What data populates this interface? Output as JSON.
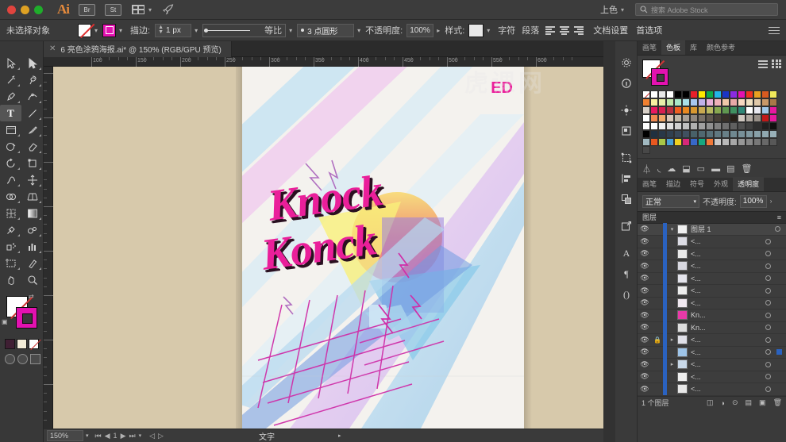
{
  "titlebar": {
    "app_name": "Ai",
    "buttons": [
      {
        "name": "bridge-button",
        "label": "Br"
      },
      {
        "name": "stock-button",
        "label": "St"
      }
    ],
    "arrange_icon": "arrange-documents-icon",
    "rocket_icon": "rocket-icon",
    "workspace_label": "上色",
    "search_placeholder": "搜索 Adobe Stock",
    "search_icon": "search-icon"
  },
  "controlbar": {
    "selection_label": "未选择对象",
    "fill_swatch": "none",
    "stroke_swatch": "#e312b0",
    "stroke_label": "描边:",
    "stroke_width": "1 px",
    "profile_label": "等比",
    "brush_label": "3 点圆形",
    "opacity_label": "不透明度:",
    "opacity_value": "100%",
    "style_label": "样式:",
    "character_label": "字符",
    "paragraph_label": "段落",
    "document_setup": "文档设置",
    "preferences": "首选项"
  },
  "document": {
    "tab_title": "6 亮色涂鸦海报.ai* @ 150% (RGB/GPU 预览)",
    "close_icon": "close-icon"
  },
  "toolbar": {
    "tools": [
      {
        "name": "selection-tool",
        "glyph": "selection"
      },
      {
        "name": "direct-selection-tool",
        "glyph": "direct"
      },
      {
        "name": "magic-wand-tool",
        "glyph": "wand"
      },
      {
        "name": "lasso-tool",
        "glyph": "lasso"
      },
      {
        "name": "pen-tool",
        "glyph": "pen"
      },
      {
        "name": "curvature-tool",
        "glyph": "curvature"
      },
      {
        "name": "type-tool",
        "glyph": "type",
        "active": true
      },
      {
        "name": "line-segment-tool",
        "glyph": "line"
      },
      {
        "name": "rectangle-tool",
        "glyph": "rect"
      },
      {
        "name": "paintbrush-tool",
        "glyph": "brush"
      },
      {
        "name": "shaper-tool",
        "glyph": "shaper"
      },
      {
        "name": "eraser-tool",
        "glyph": "eraser"
      },
      {
        "name": "rotate-tool",
        "glyph": "rotate"
      },
      {
        "name": "scale-tool",
        "glyph": "scale"
      },
      {
        "name": "width-tool",
        "glyph": "width"
      },
      {
        "name": "free-transform-tool",
        "glyph": "transform"
      },
      {
        "name": "shape-builder-tool",
        "glyph": "builder"
      },
      {
        "name": "perspective-grid-tool",
        "glyph": "perspective"
      },
      {
        "name": "mesh-tool",
        "glyph": "mesh"
      },
      {
        "name": "gradient-tool",
        "glyph": "gradient"
      },
      {
        "name": "eyedropper-tool",
        "glyph": "eyedropper"
      },
      {
        "name": "blend-tool",
        "glyph": "blend"
      },
      {
        "name": "symbol-sprayer-tool",
        "glyph": "symbol"
      },
      {
        "name": "column-graph-tool",
        "glyph": "graph"
      },
      {
        "name": "artboard-tool",
        "glyph": "artboard"
      },
      {
        "name": "slice-tool",
        "glyph": "slice"
      },
      {
        "name": "hand-tool",
        "glyph": "hand"
      },
      {
        "name": "zoom-tool",
        "glyph": "zoom"
      }
    ],
    "fill_label": "fill-swatch",
    "stroke_label": "stroke-swatch",
    "recent_colors": [
      "#3f1f33",
      "#f2ecd8",
      "none"
    ]
  },
  "artwork": {
    "heading_line1": "Knock",
    "heading_line2": "Konck",
    "badge": "ED",
    "accent_color": "#ea1f9a",
    "shadow_color": "#2a1020",
    "background": "#f4f2ee",
    "board_background": "#d7c9ab"
  },
  "rulers": {
    "h_labels": [
      "100",
      "150",
      "200",
      "250",
      "300",
      "350",
      "400",
      "450",
      "500",
      "550",
      "600"
    ]
  },
  "rail": {
    "icons": [
      "gear-icon",
      "info-icon",
      "brightness-icon",
      "align-icon",
      "transform-icon",
      "pathfinder-icon",
      "layers-stack-icon",
      "export-icon",
      "character-panel-icon",
      "paragraph-panel-icon",
      "glyphs-icon"
    ]
  },
  "panels": {
    "swatches": {
      "tabs": [
        {
          "label": "画笔",
          "active": false
        },
        {
          "label": "色板",
          "active": true
        },
        {
          "label": "库",
          "active": false
        },
        {
          "label": "颜色参考",
          "active": false
        }
      ],
      "list_view_icon": "list-view-icon",
      "grid_view_icon": "grid-view-icon",
      "rows": [
        [
          "none",
          "#ffffff",
          "#e8e8e8",
          "#ffffff",
          "#000000",
          "#000000",
          "#e8202a",
          "#ffe800",
          "#0fa94a",
          "#22b5e8",
          "#1a35c4",
          "#8a2be2",
          "#e312b0",
          "#ee3322",
          "#e8a020",
          "#d85a20",
          "#f0e85a",
          "#f08030"
        ],
        [
          "#f7f0a0",
          "#e8f0a8",
          "#c0e8a8",
          "#a8e8c8",
          "#a8e0e8",
          "#a8c8f0",
          "#c0b0e8",
          "#e8b0d8",
          "#f0b0b8",
          "#f0c8a8",
          "#e8a8a8",
          "#f8d8c0",
          "#f0e0c0",
          "#e0c8a8",
          "#c89868",
          "#a87848",
          "#d8d0c8"
        ],
        [
          "#e81860",
          "#d82050",
          "#b83040",
          "#f06020",
          "#e88820",
          "#d89830",
          "#c8a850",
          "#b8b860",
          "#88a850",
          "#609850",
          "#409060",
          "#308878",
          "#ffffff",
          "#e8e8f0",
          "#a0c8e8",
          "#e818a0",
          "#ffffff"
        ],
        [
          "#f08850",
          "#f0a868",
          "#d8c8b8",
          "#c0b8a8",
          "#a8a098",
          "#908880",
          "#787068",
          "#605850",
          "#484038",
          "#383028",
          "#282018",
          "#d0c8c0",
          "#b0a8a0",
          "#989088",
          "#c01818",
          "#e818a0",
          "#ffffff"
        ],
        [
          "#ffffff",
          "#f0f0f0",
          "#e0e0e0",
          "#d0d0d0",
          "#c0c0c0",
          "#b0b0b0",
          "#a0a0a0",
          "#909090",
          "#808080",
          "#707070",
          "#606060",
          "#505050",
          "#404040",
          "#303030",
          "#202020",
          "#101010",
          "#000000"
        ],
        [
          "#203040",
          "#283848",
          "#304050",
          "#384858",
          "#405060",
          "#486068",
          "#506870",
          "#587078",
          "#607880",
          "#688088",
          "#708890",
          "#789098",
          "#8098a0",
          "#88a0a8",
          "#90a8b0",
          "#98b0b8",
          "#a0b8c0"
        ],
        [
          "#e85820",
          "#a8c848",
          "#48a0d8",
          "#f0d020",
          "#d82878",
          "#3868c8",
          "#18a880",
          "#f07838",
          "#c8c8c8",
          "#b8b8b8",
          "#a8a8a8",
          "#989898",
          "#888888",
          "#787878",
          "#686868",
          "#585858",
          "#484848"
        ]
      ]
    },
    "transparency": {
      "tabs": [
        {
          "label": "画笔",
          "active": false
        },
        {
          "label": "描边",
          "active": false
        },
        {
          "label": "符号",
          "active": false
        },
        {
          "label": "外观",
          "active": false
        },
        {
          "label": "透明度",
          "active": true
        }
      ],
      "blend_mode": "正常",
      "opacity_label": "不透明度:",
      "opacity_value": "100%"
    },
    "layers": {
      "title": "图层",
      "root_layer": "图层 1",
      "items": [
        {
          "name": "<...",
          "locked": false,
          "selected": false,
          "thumb": "#dcdce4"
        },
        {
          "name": "<...",
          "locked": false,
          "selected": false,
          "thumb": "#e8e8e8"
        },
        {
          "name": "<...",
          "locked": false,
          "selected": false,
          "thumb": "#d8d8e0"
        },
        {
          "name": "<...",
          "locked": false,
          "selected": false,
          "thumb": "#e4e4ec"
        },
        {
          "name": "<...",
          "locked": false,
          "selected": false,
          "thumb": "#ededed"
        },
        {
          "name": "<...",
          "locked": false,
          "selected": false,
          "thumb": "#f0e8f0"
        },
        {
          "name": "Kn...",
          "locked": false,
          "selected": false,
          "thumb": "#e83aa8"
        },
        {
          "name": "Kn...",
          "locked": false,
          "selected": false,
          "thumb": "#dddddd"
        },
        {
          "name": "<...",
          "locked": true,
          "selected": false,
          "thumb": "#e0e0e8"
        },
        {
          "name": "<...",
          "locked": false,
          "selected": true,
          "thumb": "#9ec4e8"
        },
        {
          "name": "<...",
          "locked": false,
          "selected": false,
          "thumb": "#c8d8e8"
        },
        {
          "name": "<...",
          "locked": false,
          "selected": false,
          "thumb": "#eeeeee"
        },
        {
          "name": "<...",
          "locked": false,
          "selected": false,
          "thumb": "#e8e8e8"
        }
      ],
      "footer_count": "1 个图层"
    }
  },
  "statusbar": {
    "zoom_level": "150%",
    "active_tool": "文字",
    "page_number": "1"
  }
}
